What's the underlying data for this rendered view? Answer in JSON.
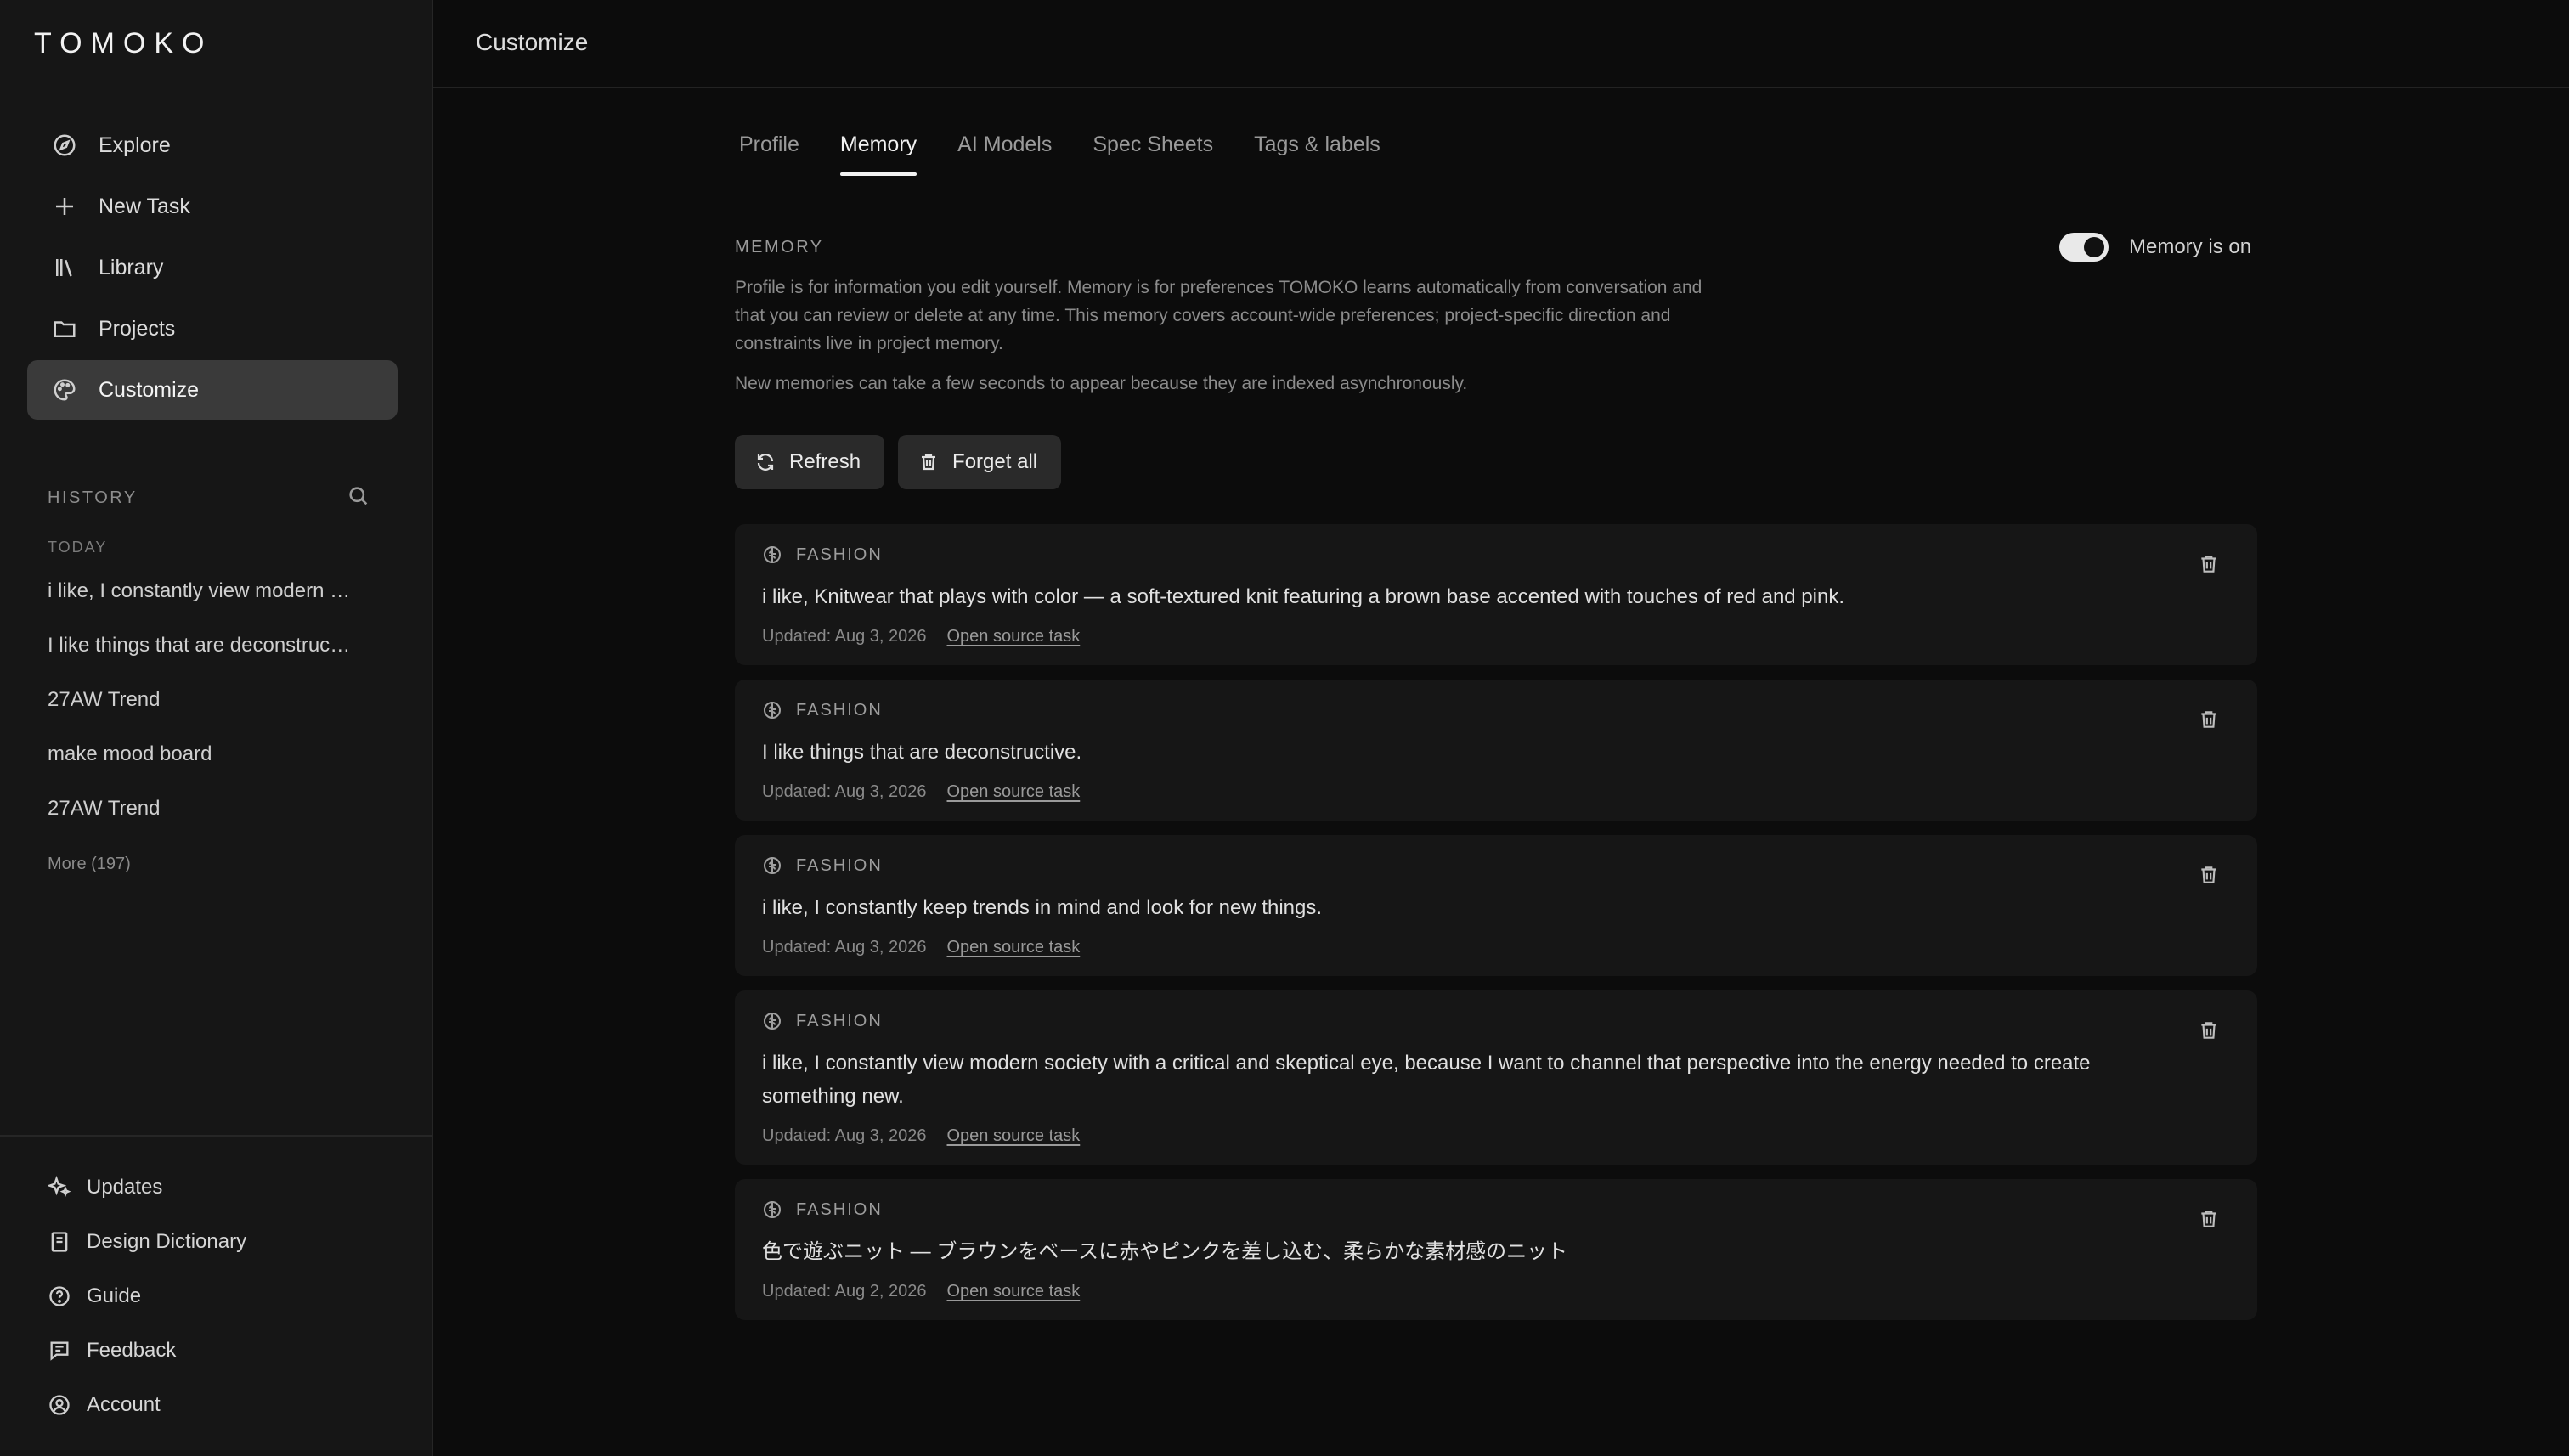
{
  "app": {
    "logo": "TOMOKO"
  },
  "nav": {
    "items": [
      {
        "label": "Explore",
        "icon": "compass-icon"
      },
      {
        "label": "New Task",
        "icon": "plus-icon"
      },
      {
        "label": "Library",
        "icon": "library-icon"
      },
      {
        "label": "Projects",
        "icon": "folder-icon"
      },
      {
        "label": "Customize",
        "icon": "palette-icon",
        "active": true
      }
    ]
  },
  "history": {
    "title": "HISTORY",
    "group_label": "TODAY",
    "items": [
      "i like, I constantly view modern society with a critical and skeptical eye, because I want to channel that perspective into the energy needed to create something new.",
      "I like things that are deconstructive.",
      "27AW Trend",
      "make mood board",
      "27AW Trend"
    ],
    "more_label": "More (197)"
  },
  "bottom_nav": {
    "items": [
      {
        "label": "Updates",
        "icon": "sparkle-icon"
      },
      {
        "label": "Design Dictionary",
        "icon": "book-icon"
      },
      {
        "label": "Guide",
        "icon": "help-circle-icon"
      },
      {
        "label": "Feedback",
        "icon": "message-icon"
      },
      {
        "label": "Account",
        "icon": "user-circle-icon"
      }
    ]
  },
  "header": {
    "title": "Customize"
  },
  "tabs": [
    {
      "label": "Profile"
    },
    {
      "label": "Memory",
      "active": true
    },
    {
      "label": "AI Models"
    },
    {
      "label": "Spec Sheets"
    },
    {
      "label": "Tags & labels"
    }
  ],
  "memory": {
    "section_label": "MEMORY",
    "toggle_label": "Memory is on",
    "toggle_on": true,
    "description": "Profile is for information you edit yourself. Memory is for preferences TOMOKO learns automatically from conversation and that you can review or delete at any time. This memory covers account-wide preferences; project-specific direction and constraints live in project memory.",
    "note": "New memories can take a few seconds to appear because they are indexed asynchronously.",
    "refresh_label": "Refresh",
    "forget_label": "Forget all",
    "link_label": "Open source task",
    "cards": [
      {
        "category": "FASHION",
        "text": "i like, Knitwear that plays with color — a soft-textured knit featuring a brown base accented with touches of red and pink.",
        "updated": "Updated: Aug 3, 2026"
      },
      {
        "category": "FASHION",
        "text": "I like things that are deconstructive.",
        "updated": "Updated: Aug 3, 2026"
      },
      {
        "category": "FASHION",
        "text": "i like, I constantly keep trends in mind and look for new things.",
        "updated": "Updated: Aug 3, 2026"
      },
      {
        "category": "FASHION",
        "text": "i like, I constantly view modern society with a critical and skeptical eye, because I want to channel that perspective into the energy needed to create something new.",
        "updated": "Updated: Aug 3, 2026"
      },
      {
        "category": "FASHION",
        "text": "色で遊ぶニット — ブラウンをベースに赤やピンクを差し込む、柔らかな素材感のニット",
        "updated": "Updated: Aug 2, 2026"
      }
    ]
  }
}
